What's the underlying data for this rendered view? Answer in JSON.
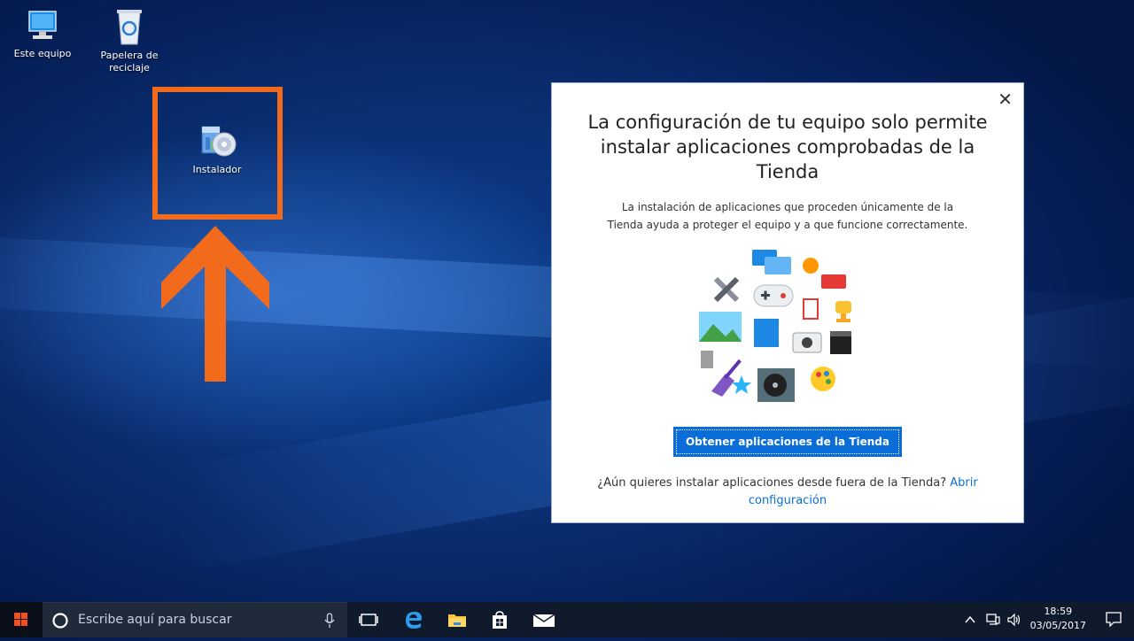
{
  "desktop": {
    "icons": [
      {
        "label": "Este equipo"
      },
      {
        "label": "Papelera de reciclaje"
      },
      {
        "label": "Instalador"
      }
    ]
  },
  "dialog": {
    "title": "La configuración de tu equipo solo permite instalar aplicaciones comprobadas de la Tienda",
    "description": "La instalación de aplicaciones que proceden únicamente de la Tienda ayuda a proteger el equipo y a que funcione correctamente.",
    "store_button": "Obtener aplicaciones de la Tienda",
    "footer_text": "¿Aún quieres instalar aplicaciones desde fuera de la Tienda? ",
    "footer_link": "Abrir configuración",
    "close_glyph": "✕"
  },
  "taskbar": {
    "search_placeholder": "Escribe aquí para buscar",
    "time": "18:59",
    "date": "03/05/2017"
  },
  "colors": {
    "highlight": "#f26a1b",
    "accent": "#0b6ed8"
  }
}
